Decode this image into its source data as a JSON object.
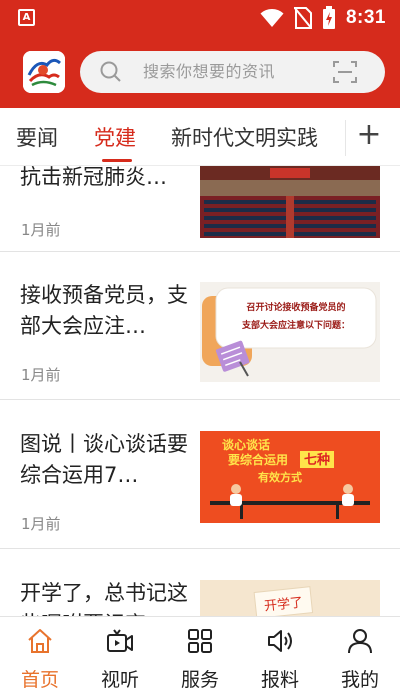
{
  "status_bar": {
    "time": "8:31",
    "app_icon": "A"
  },
  "header": {
    "search_placeholder": "搜索你想要的资讯"
  },
  "tabs": [
    {
      "label": "要闻",
      "active": false
    },
    {
      "label": "党建",
      "active": true
    },
    {
      "label": "新时代文明实践",
      "active": false
    }
  ],
  "tabs_add_label": "+",
  "feed": [
    {
      "title": "抗击新冠肺炎…",
      "time": "1月前"
    },
    {
      "title": "接收预备党员，支部大会应注…",
      "time": "1月前"
    },
    {
      "title": "图说丨谈心谈话要综合运用7…",
      "time": "1月前"
    },
    {
      "title": "开学了，总书记这些嘱咐要记牢",
      "time": ""
    }
  ],
  "thumbnails": {
    "item2_line1": "召开讨论接收预备党员的",
    "item2_line2": "支部大会应注意以下问题：",
    "item3_line1": "谈心谈话",
    "item3_line2": "要综合运用",
    "item3_highlight": "七种",
    "item3_line3": "有效方式",
    "item4_text": "开学了"
  },
  "bottom_nav": [
    {
      "label": "首页",
      "icon": "home-icon",
      "active": true
    },
    {
      "label": "视听",
      "icon": "video-icon",
      "active": false
    },
    {
      "label": "服务",
      "icon": "grid-icon",
      "active": false
    },
    {
      "label": "报料",
      "icon": "speaker-icon",
      "active": false
    },
    {
      "label": "我的",
      "icon": "user-icon",
      "active": false
    }
  ],
  "colors": {
    "brand_red": "#d62b1c",
    "nav_active": "#e8732d",
    "text": "#222222",
    "muted": "#888888"
  }
}
